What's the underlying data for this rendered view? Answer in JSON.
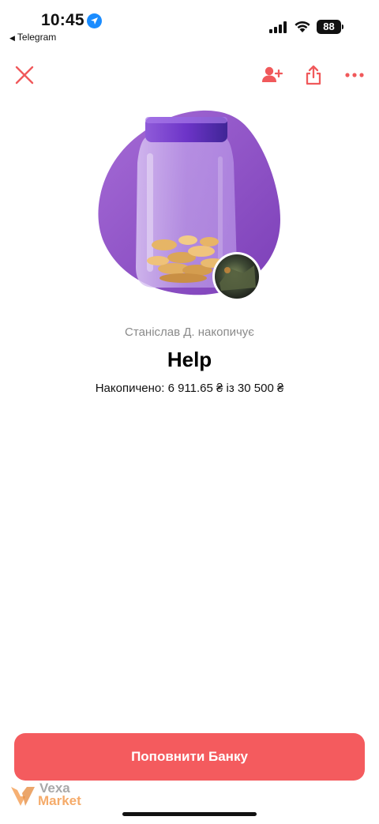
{
  "status_bar": {
    "time": "10:45",
    "back_app": "Telegram",
    "battery": "88"
  },
  "nav": {
    "close_icon": "close-icon",
    "add_user_icon": "add-user-icon",
    "share_icon": "share-icon",
    "more_icon": "more-icon",
    "accent_color": "#f0595b"
  },
  "jar": {
    "owner": "Станіслав Д. накопичує",
    "title": "Help",
    "progress": "Накопичено: 6 911.65 ₴ із 30 500 ₴",
    "collected": 6911.65,
    "goal": 30500
  },
  "actions": {
    "top_up_label": "Поповнити Банку",
    "button_color": "#f45b5e"
  },
  "watermark": {
    "line1": "Vexa",
    "line2": "Market"
  }
}
